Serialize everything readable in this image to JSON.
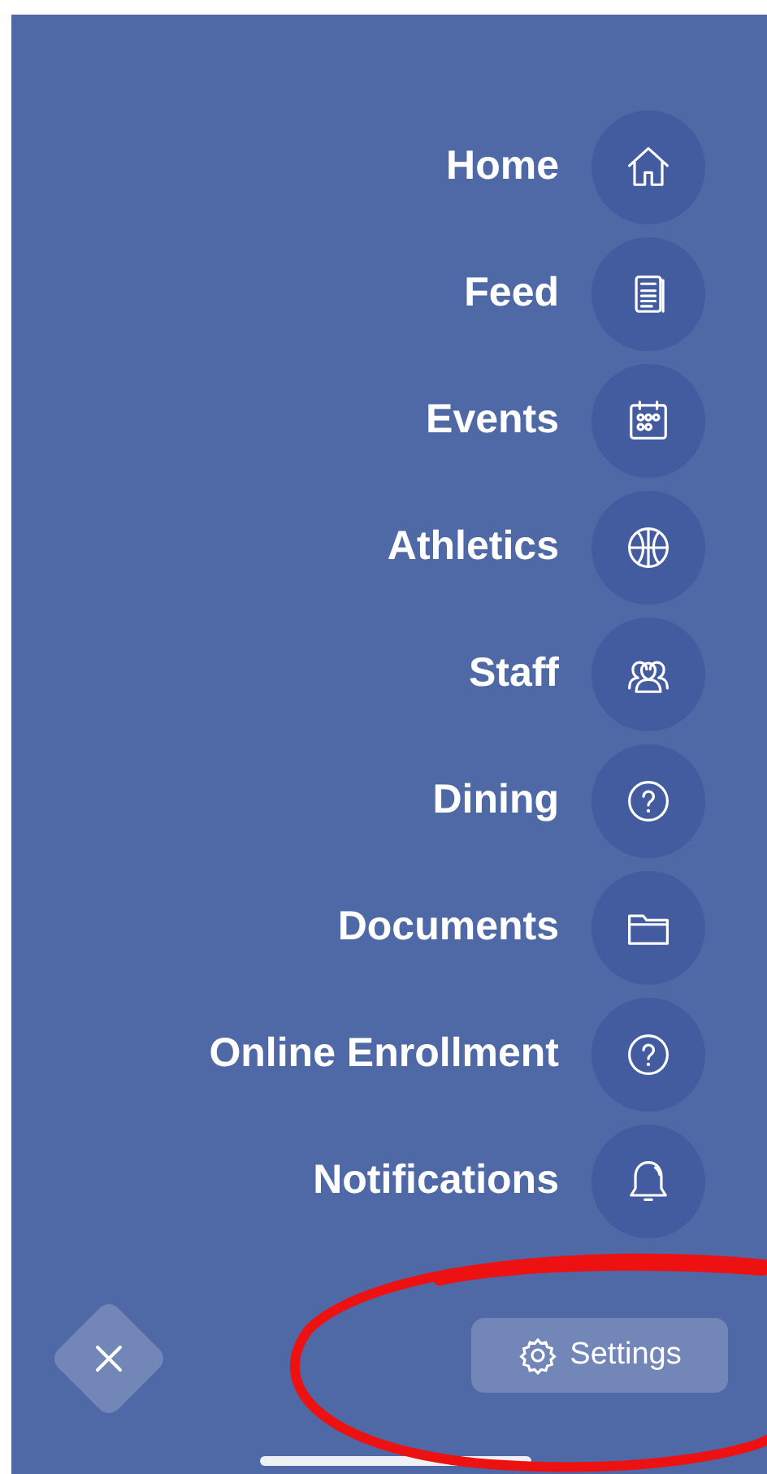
{
  "menu": {
    "items": [
      {
        "label": "Home",
        "kind": "home"
      },
      {
        "label": "Feed",
        "kind": "feed"
      },
      {
        "label": "Events",
        "kind": "calendar"
      },
      {
        "label": "Athletics",
        "kind": "ball"
      },
      {
        "label": "Staff",
        "kind": "people"
      },
      {
        "label": "Dining",
        "kind": "question"
      },
      {
        "label": "Documents",
        "kind": "folder"
      },
      {
        "label": "Online Enrollment",
        "kind": "question"
      },
      {
        "label": "Notifications",
        "kind": "bell"
      }
    ]
  },
  "settings_button": {
    "label": "Settings"
  }
}
